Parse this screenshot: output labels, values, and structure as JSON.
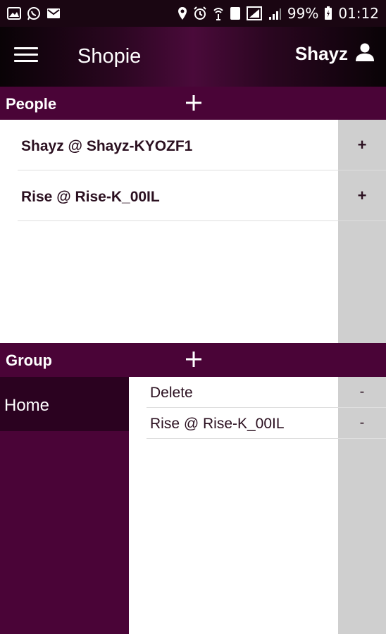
{
  "status_bar": {
    "icons_left": [
      "gallery-icon",
      "whatsapp-icon",
      "mail-icon"
    ],
    "icons_right": [
      "location-icon",
      "alarm-icon",
      "wifi-icon",
      "sim-icon",
      "signal-icon",
      "signal-bars-icon"
    ],
    "sim_number": "1",
    "battery": "99%",
    "time": "01:12"
  },
  "app_bar": {
    "title": "Shopie",
    "user_name": "Shayz"
  },
  "people": {
    "title": "People",
    "add_symbol": "+",
    "items": [
      {
        "name": "Shayz @ Shayz-KYOZF1",
        "action": "+"
      },
      {
        "name": "Rise @ Rise-K_00IL",
        "action": "+"
      }
    ]
  },
  "group": {
    "title": "Group",
    "add_symbol": "+",
    "groups": [
      {
        "name": "Home",
        "selected": true
      }
    ],
    "members": [
      {
        "name": "Delete",
        "action": "-"
      },
      {
        "name": "Rise @ Rise-K_00IL",
        "action": "-"
      }
    ]
  },
  "colors": {
    "primary": "#4a0437",
    "dark": "#1a0612",
    "selected": "#2b0220",
    "side_column": "#cfcfcf"
  }
}
